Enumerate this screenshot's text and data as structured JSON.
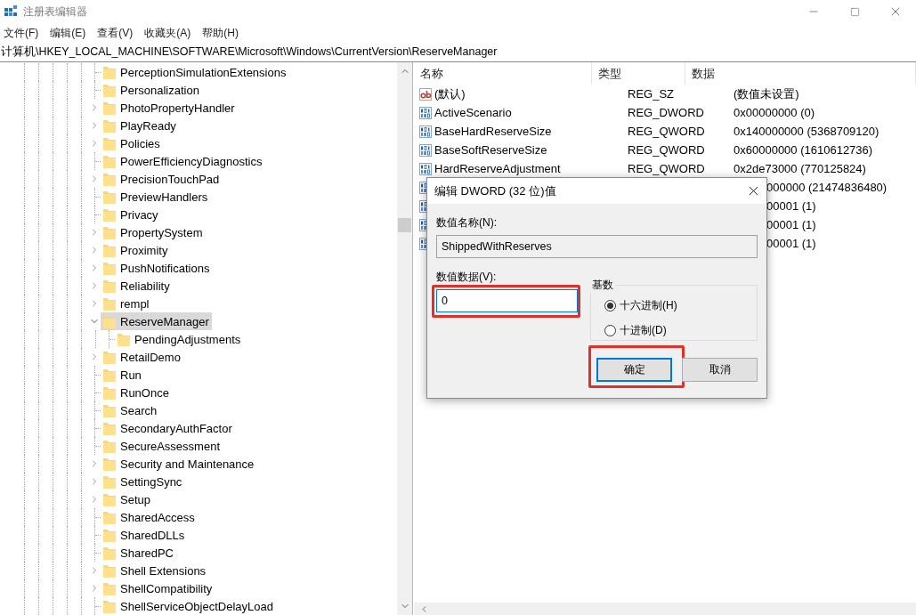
{
  "window": {
    "title": "注册表编辑器"
  },
  "menu": [
    "文件(F)",
    "编辑(E)",
    "查看(V)",
    "收藏夹(A)",
    "帮助(H)"
  ],
  "address": "计算机\\HKEY_LOCAL_MACHINE\\SOFTWARE\\Microsoft\\Windows\\CurrentVersion\\ReserveManager",
  "tree": {
    "items": [
      {
        "label": "PerceptionSimulationExtensions",
        "kind": "leaf",
        "selected": false
      },
      {
        "label": "Personalization",
        "kind": "leaf",
        "selected": false
      },
      {
        "label": "PhotoPropertyHandler",
        "kind": "branch",
        "expanded": false,
        "selected": false
      },
      {
        "label": "PlayReady",
        "kind": "branch",
        "expanded": false,
        "selected": false
      },
      {
        "label": "Policies",
        "kind": "branch",
        "expanded": false,
        "selected": false
      },
      {
        "label": "PowerEfficiencyDiagnostics",
        "kind": "leaf",
        "selected": false
      },
      {
        "label": "PrecisionTouchPad",
        "kind": "branch",
        "expanded": false,
        "selected": false
      },
      {
        "label": "PreviewHandlers",
        "kind": "leaf",
        "selected": false
      },
      {
        "label": "Privacy",
        "kind": "leaf",
        "selected": false
      },
      {
        "label": "PropertySystem",
        "kind": "branch",
        "expanded": false,
        "selected": false
      },
      {
        "label": "Proximity",
        "kind": "branch",
        "expanded": false,
        "selected": false
      },
      {
        "label": "PushNotifications",
        "kind": "branch",
        "expanded": false,
        "selected": false
      },
      {
        "label": "Reliability",
        "kind": "branch",
        "expanded": false,
        "selected": false
      },
      {
        "label": "rempl",
        "kind": "branch",
        "expanded": false,
        "selected": false
      },
      {
        "label": "ReserveManager",
        "kind": "branch",
        "expanded": true,
        "selected": true,
        "children": [
          {
            "label": "PendingAdjustments",
            "kind": "leaf",
            "selected": false
          }
        ]
      },
      {
        "label": "RetailDemo",
        "kind": "branch",
        "expanded": false,
        "selected": false
      },
      {
        "label": "Run",
        "kind": "leaf",
        "selected": false
      },
      {
        "label": "RunOnce",
        "kind": "leaf",
        "selected": false
      },
      {
        "label": "Search",
        "kind": "leaf",
        "selected": false
      },
      {
        "label": "SecondaryAuthFactor",
        "kind": "leaf",
        "selected": false
      },
      {
        "label": "SecureAssessment",
        "kind": "leaf",
        "selected": false
      },
      {
        "label": "Security and Maintenance",
        "kind": "branch",
        "expanded": false,
        "selected": false
      },
      {
        "label": "SettingSync",
        "kind": "branch",
        "expanded": false,
        "selected": false
      },
      {
        "label": "Setup",
        "kind": "branch",
        "expanded": false,
        "selected": false
      },
      {
        "label": "SharedAccess",
        "kind": "leaf",
        "selected": false
      },
      {
        "label": "SharedDLLs",
        "kind": "leaf",
        "selected": false
      },
      {
        "label": "SharedPC",
        "kind": "leaf",
        "selected": false
      },
      {
        "label": "Shell Extensions",
        "kind": "branch",
        "expanded": false,
        "selected": false
      },
      {
        "label": "ShellCompatibility",
        "kind": "branch",
        "expanded": false,
        "selected": false
      },
      {
        "label": "ShellServiceObjectDelayLoad",
        "kind": "leaf",
        "selected": false
      }
    ]
  },
  "values": {
    "columns": [
      "名称",
      "类型",
      "数据"
    ],
    "rows": [
      {
        "kind": "string",
        "name": "(默认)",
        "type": "REG_SZ",
        "data": "(数值未设置)"
      },
      {
        "kind": "binary",
        "name": "ActiveScenario",
        "type": "REG_DWORD",
        "data": "0x00000000 (0)"
      },
      {
        "kind": "binary",
        "name": "BaseHardReserveSize",
        "type": "REG_QWORD",
        "data": "0x140000000 (5368709120)"
      },
      {
        "kind": "binary",
        "name": "BaseSoftReserveSize",
        "type": "REG_QWORD",
        "data": "0x60000000 (1610612736)"
      },
      {
        "kind": "binary",
        "name": "HardReserveAdjustment",
        "type": "REG_QWORD",
        "data": "0x2de73000 (770125824)"
      },
      {
        "kind": "binary",
        "covered": true,
        "data": "000000 (21474836480)"
      },
      {
        "kind": "binary",
        "covered": true,
        "data": "00001 (1)"
      },
      {
        "kind": "binary",
        "covered": true,
        "data": "00001 (1)"
      },
      {
        "kind": "binary",
        "covered": true,
        "data": "00001 (1)"
      }
    ]
  },
  "dialog": {
    "title": "编辑 DWORD (32 位)值",
    "name_label": "数值名称(N):",
    "name_value": "ShippedWithReserves",
    "data_label": "数值数据(V):",
    "data_value": "0",
    "data_highlighted": true,
    "base_label": "基数",
    "bases": [
      {
        "label": "十六进制(H)",
        "selected": true
      },
      {
        "label": "十进制(D)",
        "selected": false
      }
    ],
    "buttons": [
      {
        "label": "确定",
        "default": true,
        "highlighted": true
      },
      {
        "label": "取消",
        "default": false,
        "highlighted": false
      }
    ]
  }
}
